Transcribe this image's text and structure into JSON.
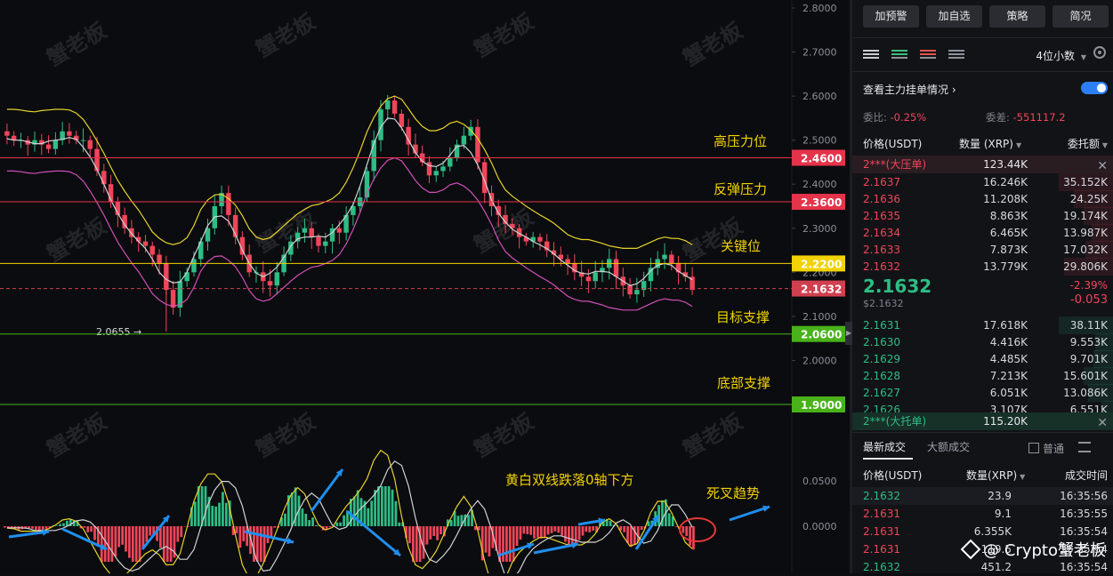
{
  "toolbar": {
    "buttons": [
      "加预警",
      "加自选",
      "策略",
      "简况"
    ]
  },
  "orderbook": {
    "decimal_label": "4位小数",
    "mainforce_label": "查看主力挂单情况",
    "ratio_label": "委比:",
    "ratio_value": "-0.25%",
    "diff_label": "委差:",
    "diff_value": "-551117.2",
    "headers": [
      "价格(USDT)",
      "数量 (XRP)",
      "委托额"
    ],
    "big_ask": {
      "label": "2***(大压单)",
      "qty": "123.44K"
    },
    "asks": [
      {
        "price": "2.1637",
        "qty": "16.246K",
        "amount": "35.152K"
      },
      {
        "price": "2.1636",
        "qty": "11.208K",
        "amount": "24.25K"
      },
      {
        "price": "2.1635",
        "qty": "8.863K",
        "amount": "19.174K"
      },
      {
        "price": "2.1634",
        "qty": "6.465K",
        "amount": "13.987K"
      },
      {
        "price": "2.1633",
        "qty": "7.873K",
        "amount": "17.032K"
      },
      {
        "price": "2.1632",
        "qty": "13.779K",
        "amount": "29.806K"
      }
    ],
    "last_price": "2.1632",
    "last_usd": "$2.1632",
    "change_pct": "-2.39%",
    "change": "-0.053",
    "bids": [
      {
        "price": "2.1631",
        "qty": "17.618K",
        "amount": "38.11K"
      },
      {
        "price": "2.1630",
        "qty": "4.416K",
        "amount": "9.553K"
      },
      {
        "price": "2.1629",
        "qty": "4.485K",
        "amount": "9.701K"
      },
      {
        "price": "2.1628",
        "qty": "7.213K",
        "amount": "15.601K"
      },
      {
        "price": "2.1627",
        "qty": "6.051K",
        "amount": "13.086K"
      },
      {
        "price": "2.1626",
        "qty": "3.107K",
        "amount": "6.551K"
      }
    ],
    "big_bid": {
      "label": "2***(大托单)",
      "qty": "115.20K"
    }
  },
  "trades": {
    "tab_latest": "最新成交",
    "tab_large": "大额成交",
    "normal_label": "普通",
    "headers": [
      "价格(USDT)",
      "数量(XRP)",
      "成交时间"
    ],
    "rows": [
      {
        "price": "2.1632",
        "qty": "23.9",
        "time": "16:35:56",
        "side": "buy"
      },
      {
        "price": "2.1631",
        "qty": "9.1",
        "time": "16:35:55",
        "side": "sell"
      },
      {
        "price": "2.1631",
        "qty": "6.355K",
        "time": "16:35:54",
        "side": "sell"
      },
      {
        "price": "2.1631",
        "qty": "119.5",
        "time": "16:35:54",
        "side": "sell"
      },
      {
        "price": "2.1632",
        "qty": "451.2",
        "time": "16:35:54",
        "side": "buy"
      }
    ]
  },
  "watermark": {
    "chart_text": "蟹老板",
    "brand": "@ Crypto蟹老板"
  },
  "chart_data": {
    "type": "candlestick",
    "y_ticks": [
      "2.8000",
      "2.7000",
      "2.6000",
      "2.5000",
      "2.4000",
      "2.3000",
      "2.2000",
      "2.1000",
      "2.0000"
    ],
    "ylim": [
      1.9,
      2.8
    ],
    "levels": [
      {
        "value": 2.46,
        "tag": "2.4600",
        "label": "高压力位",
        "color": "#e5334a"
      },
      {
        "value": 2.36,
        "tag": "2.3600",
        "label": "反弹压力",
        "color": "#e5334a"
      },
      {
        "value": 2.22,
        "tag": "2.2200",
        "label": "关键位",
        "color": "#f2d200"
      },
      {
        "value": 2.1632,
        "tag": "2.1632",
        "label": "",
        "color": "#d04050"
      },
      {
        "value": 2.06,
        "tag": "2.0600",
        "label": "目标支撑",
        "color": "#49b21a"
      },
      {
        "value": 1.9,
        "tag": "1.9000",
        "label": "底部支撑",
        "color": "#49b21a"
      }
    ],
    "low_marker": "2.0655",
    "series_close": [
      2.51,
      2.5,
      2.5,
      2.49,
      2.5,
      2.49,
      2.48,
      2.5,
      2.52,
      2.51,
      2.5,
      2.5,
      2.48,
      2.43,
      2.4,
      2.36,
      2.33,
      2.3,
      2.28,
      2.27,
      2.26,
      2.24,
      2.22,
      2.16,
      2.12,
      2.18,
      2.2,
      2.23,
      2.27,
      2.3,
      2.35,
      2.38,
      2.33,
      2.28,
      2.24,
      2.2,
      2.2,
      2.18,
      2.17,
      2.2,
      2.24,
      2.27,
      2.29,
      2.3,
      2.28,
      2.26,
      2.27,
      2.3,
      2.29,
      2.33,
      2.35,
      2.37,
      2.43,
      2.5,
      2.57,
      2.59,
      2.56,
      2.53,
      2.49,
      2.47,
      2.45,
      2.42,
      2.43,
      2.44,
      2.46,
      2.49,
      2.51,
      2.53,
      2.45,
      2.38,
      2.35,
      2.33,
      2.31,
      2.3,
      2.28,
      2.27,
      2.28,
      2.27,
      2.25,
      2.24,
      2.23,
      2.22,
      2.2,
      2.19,
      2.18,
      2.2,
      2.21,
      2.23,
      2.19,
      2.17,
      2.15,
      2.16,
      2.18,
      2.21,
      2.23,
      2.24,
      2.22,
      2.2,
      2.19,
      2.16
    ],
    "macd_ticks": [
      "0.0500",
      "0.0000"
    ],
    "annotations": [
      "黄白双线跌落0轴下方",
      "死叉趋势"
    ]
  }
}
